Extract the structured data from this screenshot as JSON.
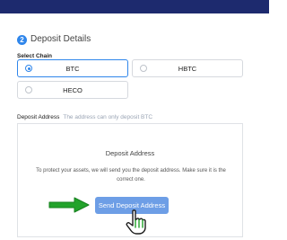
{
  "step": {
    "number": "2",
    "title": "Deposit Details"
  },
  "chain": {
    "label": "Select Chain",
    "options": [
      {
        "label": "BTC",
        "selected": true
      },
      {
        "label": "HBTC",
        "selected": false
      },
      {
        "label": "HECO",
        "selected": false
      }
    ]
  },
  "deposit_address": {
    "label": "Deposit Address",
    "hint": "The address can only deposit BTC",
    "panel_title": "Deposit Address",
    "description": "To protect your assets, we will send you the deposit address. Make sure it is the correct one.",
    "send_button_label": "Send Deposit Address"
  },
  "colors": {
    "topbar": "#1d2a6e",
    "accent": "#2f86eb",
    "button": "#6d9ee6",
    "annotation_green": "#22a32b"
  },
  "icons": {
    "arrow": "right-arrow-icon",
    "cursor": "hand-pointer-icon"
  }
}
